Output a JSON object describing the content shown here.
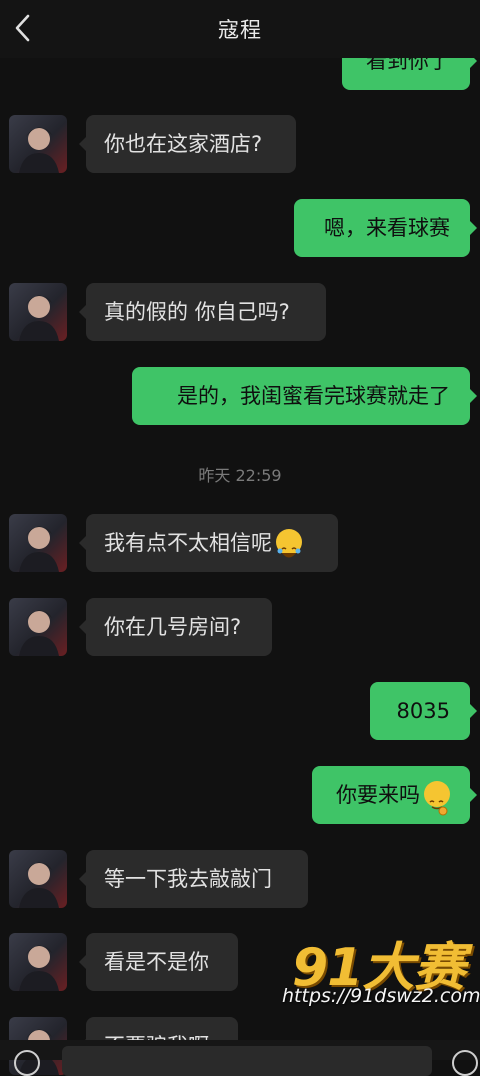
{
  "header": {
    "title": "寇程",
    "back_icon": "chevron-left-icon"
  },
  "colors": {
    "background": "#111111",
    "incoming_bubble": "#2b2b2b",
    "outgoing_bubble": "#3fc467",
    "watermark": "#f1bd34"
  },
  "messages": [
    {
      "side": "out",
      "text": "看到你了"
    },
    {
      "side": "in",
      "text": "你也在这家酒店?"
    },
    {
      "side": "out",
      "text": "嗯，来看球赛"
    },
    {
      "side": "in",
      "text": "真的假的 你自己吗?"
    },
    {
      "side": "out",
      "text": "是的，我闺蜜看完球赛就走了"
    },
    {
      "side": "in",
      "text": "我有点不太相信呢",
      "emoji": "laughing-emoji"
    },
    {
      "side": "in",
      "text": "你在几号房间?"
    },
    {
      "side": "out",
      "text": "8035"
    },
    {
      "side": "out",
      "text": "你要来吗",
      "emoji": "shy-smile-emoji"
    },
    {
      "side": "in",
      "text": "等一下我去敲敲门"
    },
    {
      "side": "in",
      "text": "看是不是你"
    },
    {
      "side": "in",
      "text": "不要骗我啊"
    }
  ],
  "timestamp": "昨天 22:59",
  "watermark": {
    "logo": "91大赛",
    "url": "https://91dswz2.com"
  }
}
